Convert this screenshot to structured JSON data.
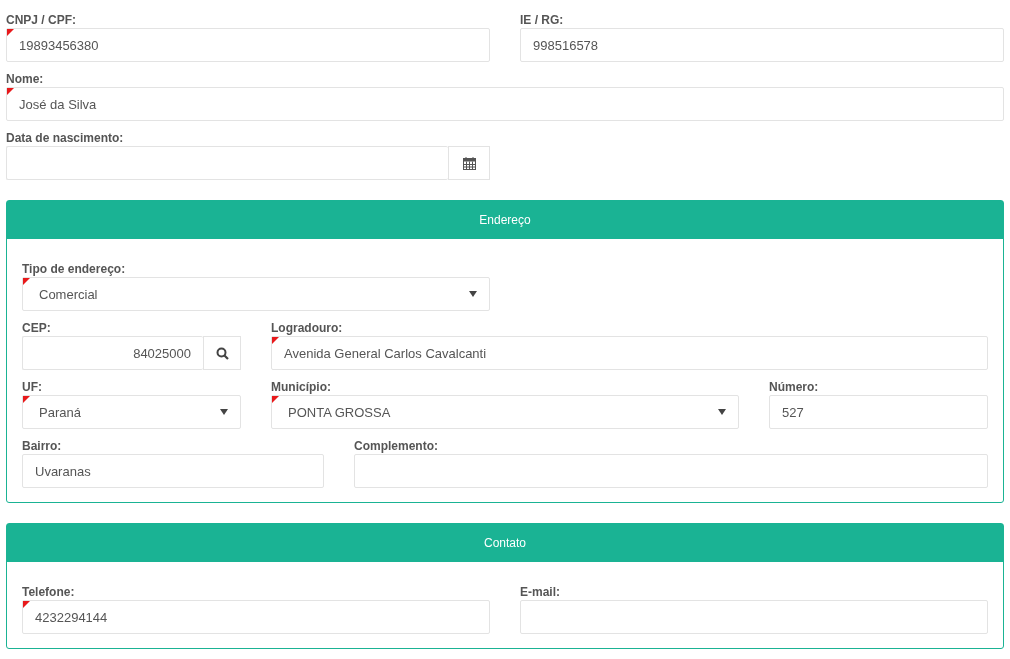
{
  "rows": [
    [
      {
        "label": "CNPJ / CPF:",
        "kind": "text",
        "value": "19893456380",
        "required": true
      },
      {
        "label": "IE / RG:",
        "kind": "text",
        "value": "998516578",
        "required": false
      }
    ],
    [
      {
        "label": "Nome:",
        "kind": "text",
        "value": "José da Silva",
        "required": true
      }
    ],
    [
      {
        "label": "Data de nascimento:",
        "kind": "date",
        "required": false
      }
    ]
  ],
  "panels": [
    {
      "title": "Endereço",
      "rows": [
        [
          {
            "label": "Tipo de endereço:",
            "kind": "select",
            "value": "Comercial",
            "required": true
          }
        ],
        [
          {
            "label": "CEP:",
            "kind": "search",
            "value": "84025000",
            "required": false
          },
          {
            "label": "Logradouro:",
            "kind": "text",
            "value": "Avenida General Carlos Cavalcanti",
            "required": true
          }
        ],
        [
          {
            "label": "UF:",
            "kind": "select",
            "value": "Paraná",
            "required": true
          },
          {
            "label": "Município:",
            "kind": "select",
            "value": "PONTA GROSSA",
            "required": true
          },
          {
            "label": "Número:",
            "kind": "text",
            "value": "527",
            "required": false
          }
        ],
        [
          {
            "label": "Bairro:",
            "kind": "text",
            "value": "Uvaranas",
            "required": false
          },
          {
            "label": "Complemento:",
            "kind": "text",
            "required": false
          }
        ]
      ]
    },
    {
      "title": "Contato",
      "rows": [
        [
          {
            "label": "Telefone:",
            "kind": "text",
            "value": "4232294144",
            "required": true
          },
          {
            "label": "E-mail:",
            "kind": "text",
            "required": false
          }
        ]
      ]
    }
  ]
}
